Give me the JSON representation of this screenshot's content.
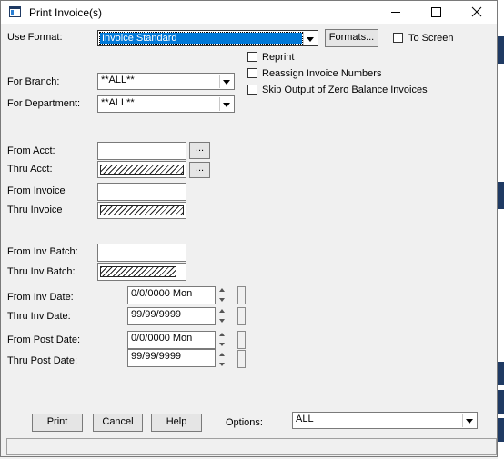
{
  "window": {
    "title": "Print Invoice(s)"
  },
  "use_format": {
    "label": "Use Format:",
    "value": "Invoice Standard",
    "formats_button": "Formats...",
    "to_screen_label": "To Screen"
  },
  "options": {
    "reprint": "Reprint",
    "reassign": "Reassign Invoice Numbers",
    "skip_zero": "Skip Output of Zero Balance Invoices"
  },
  "branch": {
    "label": "For Branch:",
    "value": "**ALL**"
  },
  "department": {
    "label": "For Department:",
    "value": "**ALL**"
  },
  "from_acct": {
    "label": "From Acct:",
    "value": ""
  },
  "thru_acct": {
    "label": "Thru Acct:"
  },
  "from_invoice": {
    "label": "From Invoice",
    "value": ""
  },
  "thru_invoice": {
    "label": "Thru Invoice"
  },
  "from_batch": {
    "label": "From Inv Batch:",
    "value": ""
  },
  "thru_batch": {
    "label": "Thru Inv Batch:"
  },
  "from_inv_date": {
    "label": "From Inv Date:",
    "value": "0/0/0000 Mon"
  },
  "thru_inv_date": {
    "label": "Thru Inv Date:",
    "value": "99/99/9999"
  },
  "from_post_date": {
    "label": "From Post Date:",
    "value": "0/0/0000 Mon"
  },
  "thru_post_date": {
    "label": "Thru Post Date:",
    "value": "99/99/9999"
  },
  "ellipsis": "...",
  "buttons": {
    "print": "Print",
    "cancel": "Cancel",
    "help": "Help"
  },
  "options_combo": {
    "label": "Options:",
    "value": "ALL"
  }
}
